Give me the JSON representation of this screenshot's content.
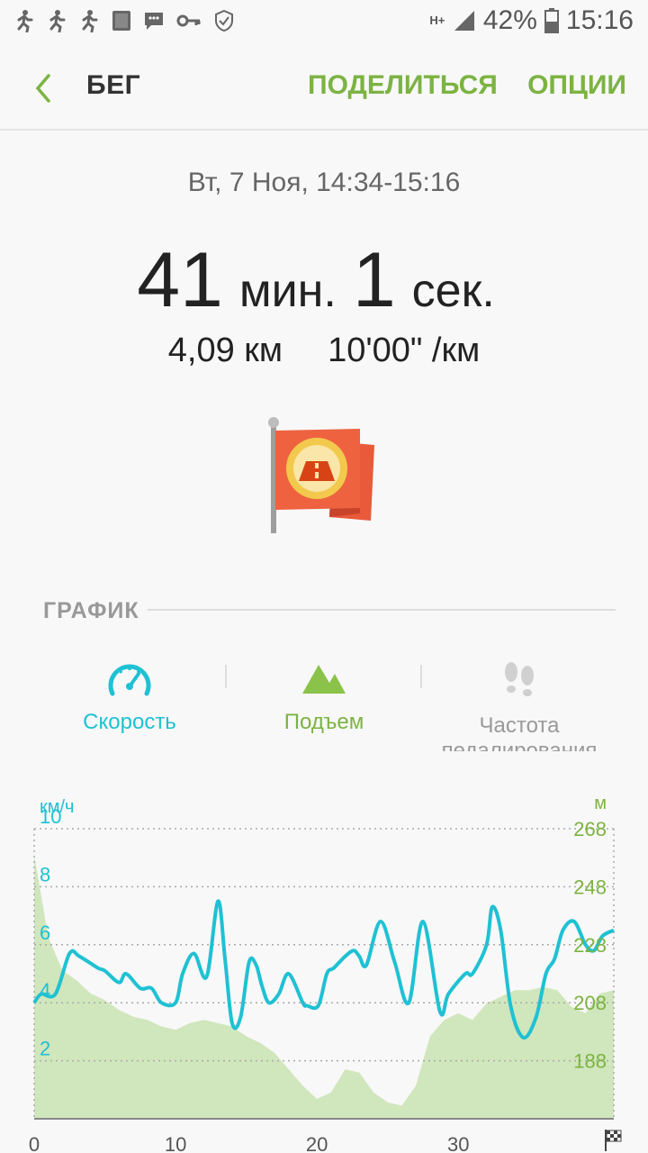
{
  "status": {
    "net": "H+",
    "battery": "42%",
    "time": "15:16"
  },
  "appbar": {
    "title": "БЕГ",
    "share": "ПОДЕЛИТЬСЯ",
    "options": "ОПЦИИ"
  },
  "workout": {
    "datetime": "Вт, 7 Ноя, 14:34-15:16",
    "minutes": "41",
    "minutes_unit": "мин.",
    "seconds": "1",
    "seconds_unit": "сек.",
    "distance": "4,09 км",
    "pace": "10'00\" /км"
  },
  "graph": {
    "section_label": "ГРАФИК",
    "tabs": [
      {
        "label": "Скорость",
        "color": "#1fc1d3"
      },
      {
        "label": "Подъем",
        "color": "#7cb342"
      },
      {
        "label": "Частота педалирования",
        "color": "#999999"
      }
    ]
  },
  "chart_data": {
    "type": "line",
    "left_axis": {
      "unit": "км/ч",
      "ticks": [
        "10",
        "8",
        "6",
        "4",
        "2"
      ],
      "ylim": [
        0,
        10
      ]
    },
    "right_axis": {
      "unit": "м",
      "ticks": [
        "268",
        "248",
        "228",
        "208",
        "188"
      ],
      "ylim": [
        180,
        268
      ]
    },
    "x_ticks": [
      "0",
      "10",
      "20",
      "30"
    ],
    "xlim": [
      0,
      41
    ],
    "grid": true,
    "series": [
      {
        "axis": "left",
        "color": "#1fc1d3",
        "x": [
          0,
          0.5,
          1.5,
          2.5,
          3.2,
          4.5,
          5,
          6,
          6.5,
          7.5,
          8.3,
          9,
          10,
          10.5,
          11.3,
          12.2,
          13,
          13.5,
          14,
          14.6,
          15.2,
          15.7,
          16.1,
          16.6,
          17.3,
          18,
          19,
          19.3,
          20.1,
          20.7,
          21.2,
          22,
          22.6,
          23,
          23.5,
          24.5,
          25.5,
          26.5,
          27.5,
          28.7,
          29.3,
          30.5,
          31,
          32,
          32.4,
          33,
          33.7,
          34.6,
          35.5,
          36.2,
          36.8,
          37.4,
          38.2,
          39,
          39.6,
          40.2,
          41
        ],
        "values": [
          4.0,
          4.3,
          4.3,
          5.7,
          5.6,
          5.2,
          5.1,
          4.7,
          5.0,
          4.5,
          4.5,
          4.0,
          4.0,
          5.0,
          5.7,
          4.9,
          7.5,
          5.5,
          3.3,
          3.5,
          5.4,
          5.3,
          4.6,
          4.0,
          4.3,
          5.0,
          4.0,
          3.9,
          3.9,
          5.0,
          5.2,
          5.6,
          5.8,
          5.6,
          5.3,
          6.8,
          5.4,
          4.0,
          6.8,
          3.7,
          4.3,
          5.0,
          5.0,
          6.0,
          7.3,
          6.5,
          3.9,
          2.8,
          3.5,
          5.0,
          5.5,
          6.5,
          6.8,
          6.0,
          5.8,
          6.3,
          6.5
        ]
      },
      {
        "axis": "right",
        "color": "#c9e3b1",
        "x": [
          0,
          1,
          2,
          3,
          4,
          5,
          6,
          7,
          8,
          9,
          10,
          11,
          12,
          13,
          14,
          15,
          16,
          17,
          18,
          19,
          20,
          21,
          22,
          23,
          24,
          25,
          26,
          27,
          28,
          29,
          30,
          31,
          32,
          33,
          34,
          35,
          36,
          37,
          38,
          39,
          40,
          41
        ],
        "values": [
          260,
          235,
          225,
          222,
          218,
          216,
          213,
          211,
          210,
          208,
          207,
          209,
          210,
          209,
          208,
          205,
          203,
          200,
          195,
          190,
          186,
          188,
          195,
          194,
          188,
          185,
          184,
          190,
          205,
          210,
          212,
          210,
          215,
          217,
          219,
          219,
          220,
          219,
          214,
          212,
          218,
          219
        ]
      }
    ]
  }
}
